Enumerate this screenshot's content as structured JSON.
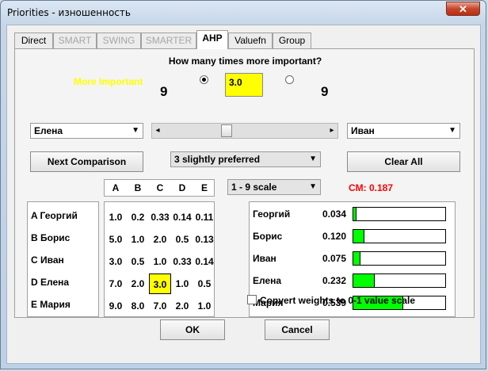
{
  "window": {
    "title": "Priorities - изношенность",
    "close_glyph": "✕"
  },
  "tabs": [
    {
      "label": "Direct",
      "state": "normal"
    },
    {
      "label": "SMART",
      "state": "disabled"
    },
    {
      "label": "SWING",
      "state": "disabled"
    },
    {
      "label": "SMARTER",
      "state": "disabled"
    },
    {
      "label": "AHP",
      "state": "active"
    },
    {
      "label": "Valuefn",
      "state": "normal"
    },
    {
      "label": "Group",
      "state": "normal"
    }
  ],
  "ahp": {
    "question": "How many times more important?",
    "more_important_label": "More Important",
    "ratio_value": "3.0",
    "left_scale_label": "9",
    "right_scale_label": "9",
    "left_item": "Елена",
    "right_item": "Иван",
    "slider_left_arrow": "◂",
    "slider_right_arrow": "▸",
    "next_comparison": "Next Comparison",
    "preference": "3 slightly preferred",
    "clear_all": "Clear All",
    "scale": "1 - 9 scale",
    "cm_label": "CM: 0.187",
    "cm_color": "#ff0000",
    "matrix": {
      "columns": [
        "A",
        "B",
        "C",
        "D",
        "E"
      ],
      "row_labels": [
        "A Георгий",
        "B Борис",
        "C Иван",
        "D Елена",
        "E Мария"
      ],
      "rows": [
        [
          "1.0",
          "0.2",
          "0.33",
          "0.14",
          "0.11"
        ],
        [
          "5.0",
          "1.0",
          "2.0",
          "0.5",
          "0.13"
        ],
        [
          "3.0",
          "0.5",
          "1.0",
          "0.33",
          "0.14"
        ],
        [
          "7.0",
          "2.0",
          "3.0",
          "1.0",
          "0.5"
        ],
        [
          "9.0",
          "8.0",
          "7.0",
          "2.0",
          "1.0"
        ]
      ],
      "highlight": {
        "row": 3,
        "col": 2,
        "color": "#ffff00"
      }
    },
    "weights": [
      {
        "name": "Георгий",
        "value": "0.034",
        "fraction": 0.034
      },
      {
        "name": "Борис",
        "value": "0.120",
        "fraction": 0.12
      },
      {
        "name": "Иван",
        "value": "0.075",
        "fraction": 0.075
      },
      {
        "name": "Елена",
        "value": "0.232",
        "fraction": 0.232
      },
      {
        "name": "Мария",
        "value": "0.539",
        "fraction": 0.539
      }
    ],
    "bar_color": "#00ff00",
    "convert_checkbox": {
      "label": "Convert weights to 0-1 value scale",
      "checked": false
    }
  },
  "footer": {
    "ok": "OK",
    "cancel": "Cancel"
  },
  "dropdown_glyph": "▼"
}
